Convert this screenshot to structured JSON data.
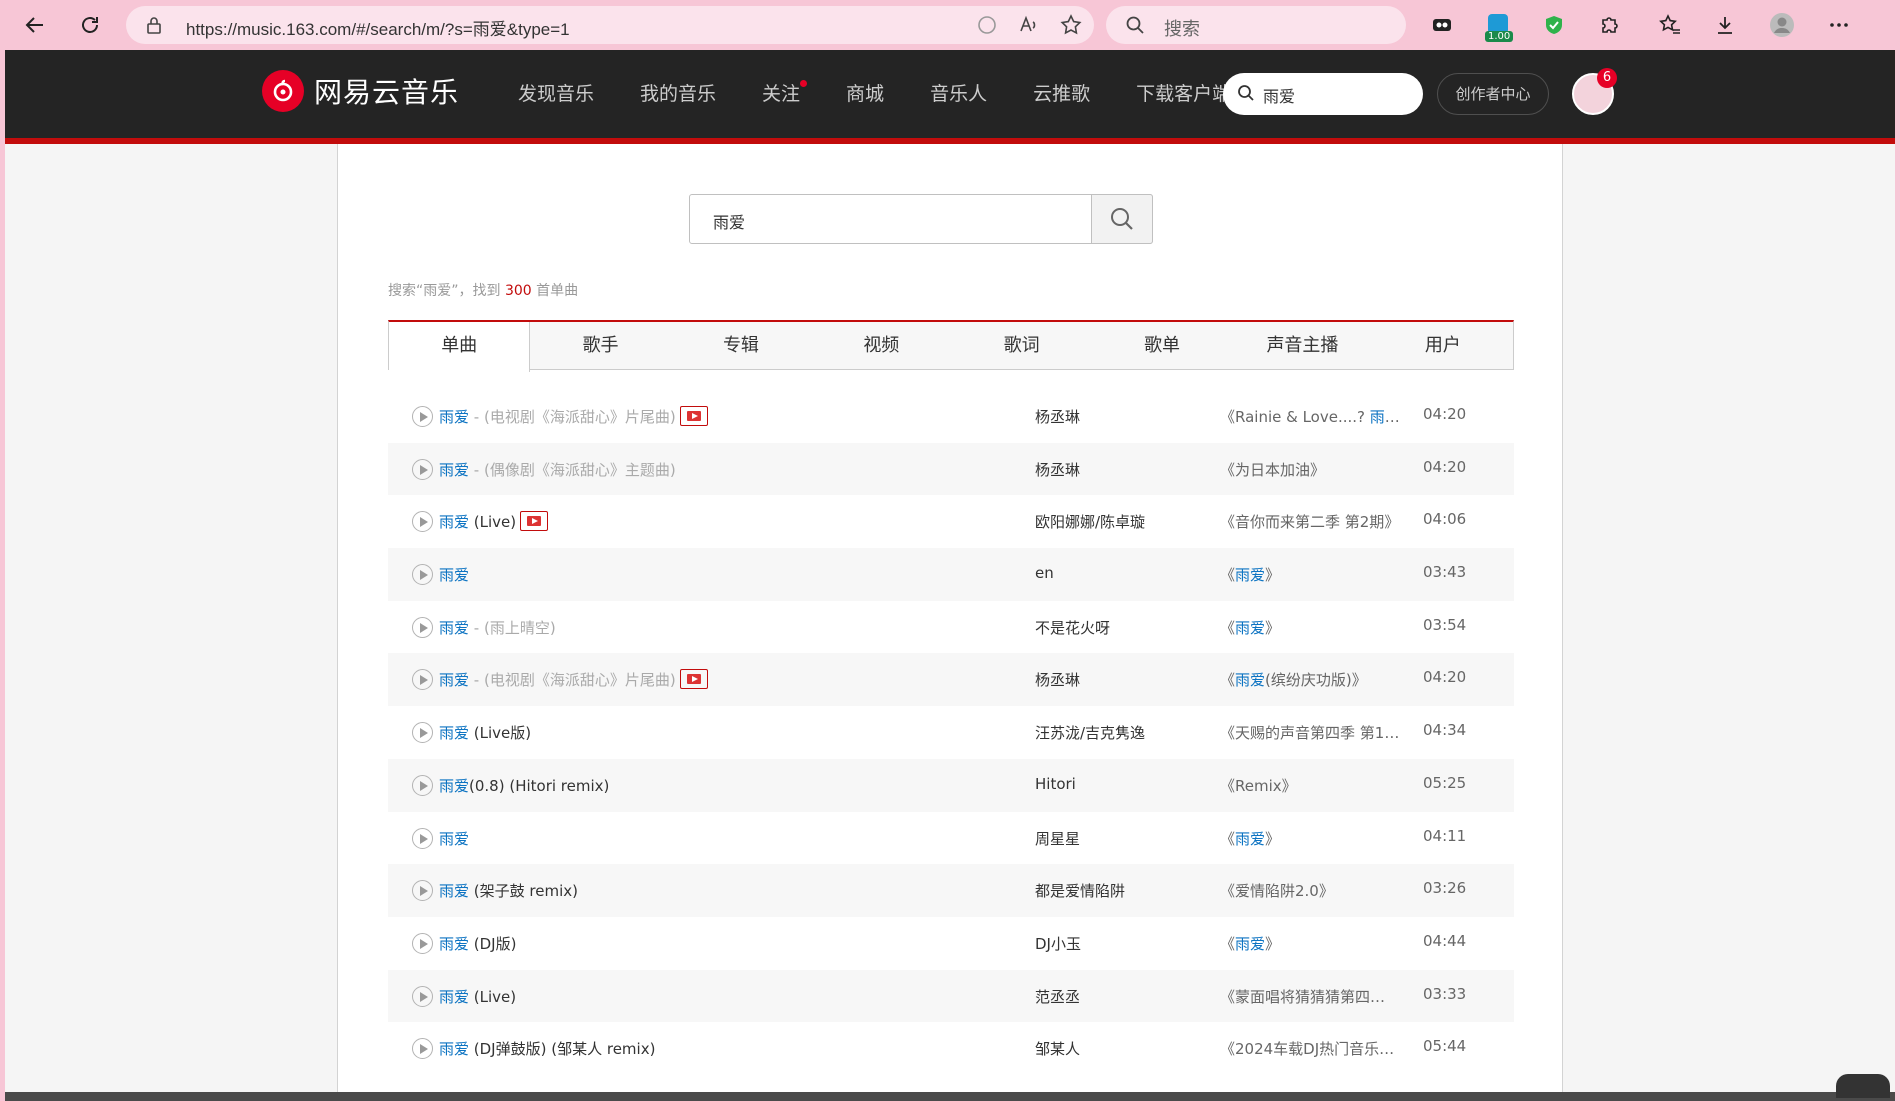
{
  "browser": {
    "url": "https://music.163.com/#/search/m/?s=雨爱&type=1",
    "search_placeholder": "搜索",
    "ext_badge": "1.00"
  },
  "header": {
    "logo_text": "网易云音乐",
    "nav": [
      "发现音乐",
      "我的音乐",
      "关注",
      "商城",
      "音乐人",
      "云推歌",
      "下载客户端"
    ],
    "search_value": "雨爱",
    "creator_label": "创作者中心",
    "notification_count": "6"
  },
  "search": {
    "value": "雨爱",
    "summary_prefix": "搜索“雨爱”，找到",
    "summary_count": "300",
    "summary_suffix": "首单曲"
  },
  "tabs": [
    "单曲",
    "歌手",
    "专辑",
    "视频",
    "歌词",
    "歌单",
    "声音主播",
    "用户"
  ],
  "songs": [
    {
      "kw": "雨爱",
      "extra": "",
      "alias": " - (电视剧《海派甜心》片尾曲)",
      "mv": true,
      "artist": "杨丞琳",
      "album_pre": "《Rainie & Love....? ",
      "album_kw": "雨爱",
      "album_post": "》",
      "duration": "04:20"
    },
    {
      "kw": "雨爱",
      "extra": "",
      "alias": " - (偶像剧《海派甜心》主题曲)",
      "mv": false,
      "artist": "杨丞琳",
      "album_pre": "《为日本加油》",
      "album_kw": "",
      "album_post": "",
      "duration": "04:20"
    },
    {
      "kw": "雨爱",
      "extra": " (Live)",
      "alias": "",
      "mv": true,
      "artist": "欧阳娜娜/陈卓璇",
      "album_pre": "《音你而来第二季 第2期》",
      "album_kw": "",
      "album_post": "",
      "duration": "04:06"
    },
    {
      "kw": "雨爱",
      "extra": "",
      "alias": "",
      "mv": false,
      "artist": "en",
      "album_pre": "《",
      "album_kw": "雨爱",
      "album_post": "》",
      "duration": "03:43"
    },
    {
      "kw": "雨爱",
      "extra": "",
      "alias": " - (雨上晴空)",
      "mv": false,
      "artist": "不是花火呀",
      "album_pre": "《",
      "album_kw": "雨爱",
      "album_post": "》",
      "duration": "03:54"
    },
    {
      "kw": "雨爱",
      "extra": "",
      "alias": " - (电视剧《海派甜心》片尾曲)",
      "mv": true,
      "artist": "杨丞琳",
      "album_pre": "《",
      "album_kw": "雨爱",
      "album_post": "(缤纷庆功版)》",
      "duration": "04:20"
    },
    {
      "kw": "雨爱",
      "extra": " (Live版)",
      "alias": "",
      "mv": false,
      "artist": "汪苏泷/吉克隽逸",
      "album_pre": "《天赐的声音第四季 第11...",
      "album_kw": "",
      "album_post": "",
      "duration": "04:34"
    },
    {
      "kw": "雨爱",
      "extra": "(0.8)  (Hitori remix)",
      "alias": "",
      "mv": false,
      "artist": "Hitori",
      "album_pre": "《Remix》",
      "album_kw": "",
      "album_post": "",
      "duration": "05:25"
    },
    {
      "kw": "雨爱",
      "extra": "",
      "alias": "",
      "mv": false,
      "artist": "周星星",
      "album_pre": "《",
      "album_kw": "雨爱",
      "album_post": "》",
      "duration": "04:11"
    },
    {
      "kw": "雨爱",
      "extra": "  (架子鼓 remix)",
      "alias": "",
      "mv": false,
      "artist": "都是爱情陷阱",
      "album_pre": "《爱情陷阱2.0》",
      "album_kw": "",
      "album_post": "",
      "duration": "03:26"
    },
    {
      "kw": "雨爱",
      "extra": "  (DJ版)",
      "alias": "",
      "mv": false,
      "artist": "DJ小玉",
      "album_pre": "《",
      "album_kw": "雨爱",
      "album_post": "》",
      "duration": "04:44"
    },
    {
      "kw": "雨爱",
      "extra": " (Live)",
      "alias": "",
      "mv": false,
      "artist": "范丞丞",
      "album_pre": "《蒙面唱将猜猜猜第四季 ...",
      "album_kw": "",
      "album_post": "",
      "duration": "03:33"
    },
    {
      "kw": "雨爱",
      "extra": "  (DJ弹鼓版)   (邹某人 remix)",
      "alias": "",
      "mv": false,
      "artist": "邹某人",
      "album_pre": "《2024车载DJ热门音乐第...",
      "album_kw": "",
      "album_post": "",
      "duration": "05:44"
    }
  ]
}
